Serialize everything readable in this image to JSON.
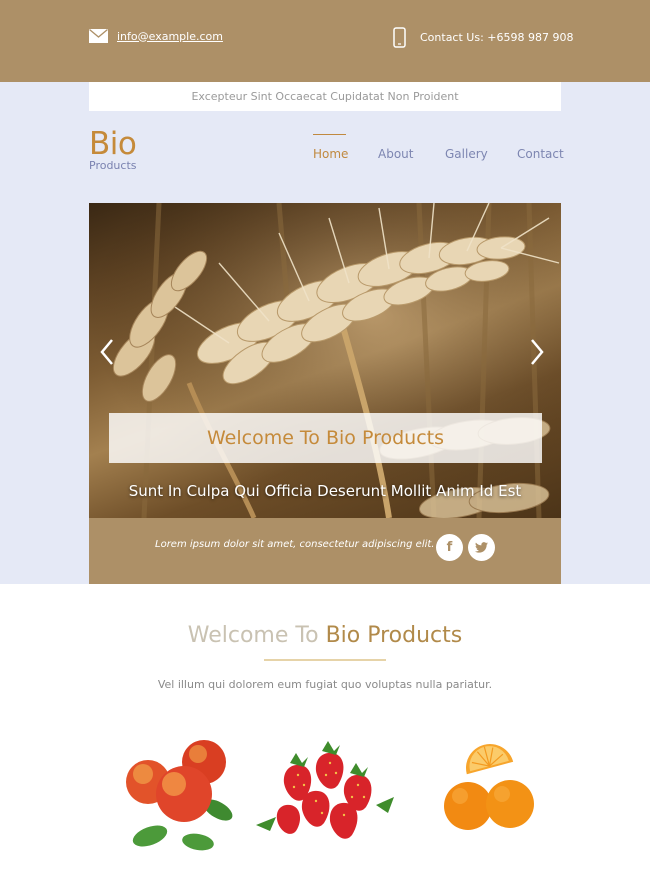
{
  "topbar": {
    "email": "info@example.com",
    "contact": "Contact Us: +6598 987 908",
    "email_icon": "envelope-icon",
    "phone_icon": "mobile-phone-icon"
  },
  "banner": {
    "text": "Excepteur Sint Occaecat Cupidatat Non Proident"
  },
  "logo": {
    "title": "Bio",
    "subtitle": "Products"
  },
  "nav": {
    "items": [
      {
        "label": "Home",
        "active": true
      },
      {
        "label": "About",
        "active": false
      },
      {
        "label": "Gallery",
        "active": false
      },
      {
        "label": "Contact",
        "active": false
      }
    ]
  },
  "slider": {
    "caption": "Welcome To Bio Products",
    "subtitle": "Sunt In Culpa Qui Officia Deserunt Mollit Anim Id Est",
    "prev_icon": "chevron-left-icon",
    "next_icon": "chevron-right-icon"
  },
  "social": {
    "text": "Lorem ipsum dolor sit amet, consectetur adipiscing elit.",
    "facebook_label": "f",
    "twitter_icon": "twitter-bird-icon"
  },
  "welcome": {
    "title_prefix": "Welcome To",
    "title_accent": "Bio Products",
    "subtitle": "Vel illum qui dolorem eum fugiat quo voluptas nulla pariatur."
  },
  "products": [
    "peaches-image",
    "strawberries-image",
    "oranges-image"
  ],
  "colors": {
    "brand_brown": "#ad9067",
    "accent_orange": "#c58a3a",
    "nav_blue": "#7d86b1",
    "hero_bg": "#e5e9f6"
  }
}
